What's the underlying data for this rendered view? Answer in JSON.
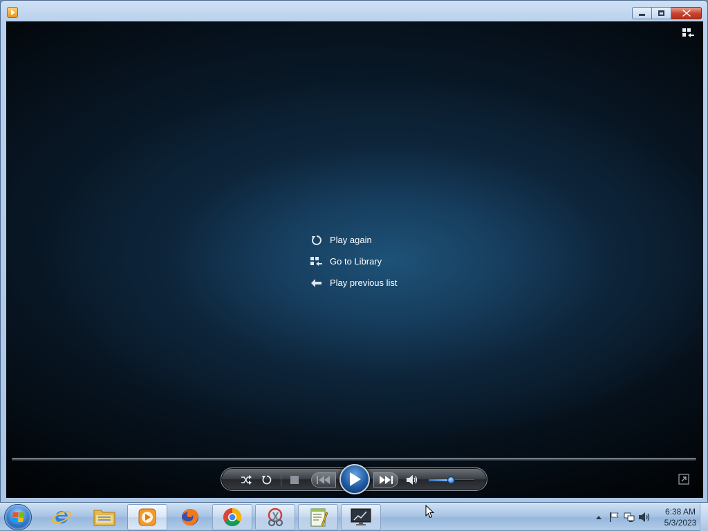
{
  "window": {
    "title": "",
    "icon": "media-player-icon",
    "controls": [
      "minimize-icon",
      "maximize-icon",
      "close-icon"
    ]
  },
  "player": {
    "menu": [
      {
        "label": "Play again",
        "icon": "replay-icon"
      },
      {
        "label": "Go to Library",
        "icon": "library-icon"
      },
      {
        "label": "Play previous list",
        "icon": "back-arrow-icon"
      }
    ],
    "volume_level": 0.5,
    "colors": {
      "accent": "#1e5aa3",
      "background": "#0a1a2a",
      "menu_text": "#ffffff"
    }
  },
  "taskbar": {
    "items": [
      {
        "name": "internet-explorer",
        "icon": "ie-icon"
      },
      {
        "name": "windows-explorer",
        "icon": "folder-icon"
      },
      {
        "name": "windows-media-player",
        "icon": "media-player-icon",
        "active": true
      },
      {
        "name": "firefox",
        "icon": "firefox-icon"
      },
      {
        "name": "chrome",
        "icon": "chrome-icon"
      },
      {
        "name": "snipping-tool",
        "icon": "scissors-icon"
      },
      {
        "name": "notepad-plus",
        "icon": "notepad-icon"
      },
      {
        "name": "remote-desktop",
        "icon": "monitor-icon"
      }
    ],
    "clock": {
      "time": "6:38 AM",
      "date": "5/3/2023"
    }
  }
}
